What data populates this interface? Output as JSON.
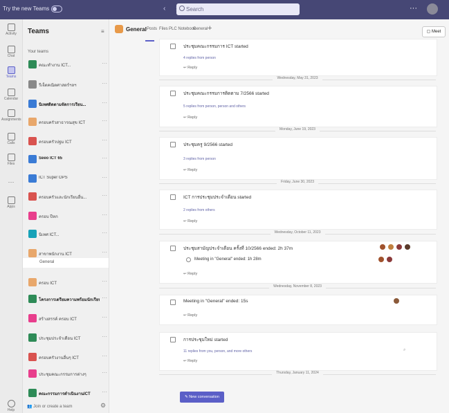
{
  "topbar": {
    "try_label": "Try the new Teams",
    "search_placeholder": "Search",
    "more": "···"
  },
  "rail": [
    {
      "label": "Activity"
    },
    {
      "label": "Chat"
    },
    {
      "label": "Teams"
    },
    {
      "label": "Calendar"
    },
    {
      "label": "Assignments"
    },
    {
      "label": "Calls"
    },
    {
      "label": "Files"
    },
    {
      "label": "···"
    },
    {
      "label": "Apps"
    },
    {
      "label": "Help"
    }
  ],
  "sidebar": {
    "title": "Teams",
    "filter_icon": "filter-icon",
    "section": "Your teams",
    "teams": [
      {
        "name": "คณะทำงาน ICT...",
        "color": "#2e8b57",
        "bold": false
      },
      {
        "name": "รีเจ็ตคณิตศาสตร์ฯลฯ",
        "color": "#888888",
        "bold": false
      },
      {
        "name": "นิเทศติดตามจัดการเรียน...",
        "color": "#3a7bd5",
        "bold": true
      },
      {
        "name": "ครอบครัวสาธารณสุข ICT",
        "color": "#e8a76b",
        "bold": false
      },
      {
        "name": "ครอบครัวปฐม ICT",
        "color": "#d9534f",
        "bold": false
      },
      {
        "name": "Seeo ICT 65",
        "color": "#3a7bd5",
        "bold": true
      },
      {
        "name": "ICT Super OPS",
        "color": "#3a7bd5",
        "bold": false
      },
      {
        "name": "ครอบครัวและนักเรียนอื่น...",
        "color": "#d9534f",
        "bold": false
      },
      {
        "name": "ครอบ ปีหก",
        "color": "#e83e8c",
        "bold": false
      },
      {
        "name": "นิเทศ ICT...",
        "color": "#17a2b8",
        "bold": false
      },
      {
        "name": "สาขาพนักงาน ICT",
        "color": "#e8a76b",
        "bold": false
      },
      {
        "name": "ครอบ ICT",
        "color": "#e8a76b",
        "bold": false
      },
      {
        "name": "โครงการเตรียมความพร้อมนักเรียน",
        "color": "#2e8b57",
        "bold": true
      },
      {
        "name": "สร้างสรรค์ ครอบ ICT",
        "color": "#e83e8c",
        "bold": false
      },
      {
        "name": "ประชุมประจำเดือน ICT",
        "color": "#2e8b57",
        "bold": false
      },
      {
        "name": "ครอบครัวงานอื่นๆ ICT",
        "color": "#d9534f",
        "bold": false
      },
      {
        "name": "ประชุมคณะกรรมการต่างๆ",
        "color": "#e83e8c",
        "bold": false
      },
      {
        "name": "คณะกรรมการดำเนินงานICT",
        "color": "#2e8b57",
        "bold": true
      }
    ],
    "active_channel": "General",
    "join_label": "Join or create a team"
  },
  "channel": {
    "name": "General",
    "tabs": [
      "Posts",
      "Files",
      "PLC Notebook",
      "General"
    ],
    "meet_label": "Meet"
  },
  "feed": {
    "cards": [
      {
        "title": "ประชุมคณะกรรมการ ICT started",
        "replies": "4 replies from person",
        "reply": "↩ Reply"
      },
      {
        "title": "ประชุมคณะกรรมการติดตาม 7/2566 started",
        "replies": "5 replies from person, person and others",
        "reply": "↩ Reply"
      },
      {
        "title": "ประชุมครู 9/2566 started",
        "replies": "3 replies from person",
        "reply": "↩ Reply"
      },
      {
        "title": "ICT การประชุมประจำเดือน started",
        "replies": "2 replies from others",
        "reply": "↩ Reply"
      },
      {
        "title": "ประชุมสามัญประจำเดือน ครั้งที่ 10/2566 ended: 2h 37m",
        "sub": "Meeting in \"General\" ended: 1h 28m",
        "reply": "↩ Reply"
      },
      {
        "title": "Meeting in \"General\" ended: 15s",
        "reply": "↩ Reply"
      },
      {
        "title": "การประชุมใหม่ started",
        "replies": "11 replies from you, person, and more others",
        "reply": "↩ Reply"
      }
    ],
    "dates": [
      "Wednesday, May 31, 2023",
      "Monday, June 19, 2023",
      "Friday, June 30, 2023",
      "Wednesday, October 11, 2023",
      "Wednesday, November 8, 2023",
      "Thursday, January 11, 2024"
    ],
    "new_conversation": "New conversation"
  }
}
